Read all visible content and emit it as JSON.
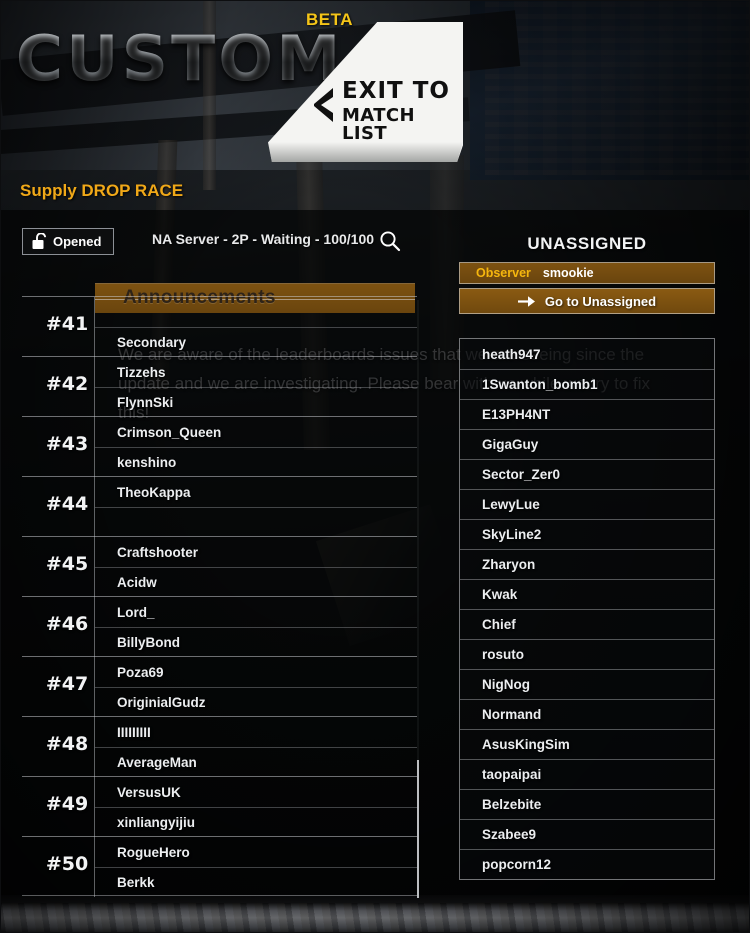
{
  "header": {
    "title": "CUSTOM",
    "beta_badge": "BETA",
    "exit_button": {
      "line1": "EXIT TO",
      "line2": "MATCH LIST",
      "icon": "chevron-left-icon"
    },
    "mode_label": "Supply DROP RACE"
  },
  "statusbar": {
    "lock": {
      "label": "Opened",
      "icon": "unlocked-padlock-icon"
    },
    "server_info": "NA Server - 2P - Waiting - 100/100",
    "search_icon": "search-icon"
  },
  "announcements": {
    "title": "Announcements",
    "body": "We are aware of the leaderboards issues that we are seeing since the update and we are investigating. Please bear with us while we try to fix this!"
  },
  "teams": [
    {
      "number": "#41",
      "slots": [
        "",
        "Secondary"
      ]
    },
    {
      "number": "#42",
      "slots": [
        "Tizzehs",
        "FlynnSki"
      ]
    },
    {
      "number": "#43",
      "slots": [
        "Crimson_Queen",
        "kenshino"
      ]
    },
    {
      "number": "#44",
      "slots": [
        "TheoKappa",
        ""
      ]
    },
    {
      "number": "#45",
      "slots": [
        "Craftshooter",
        "Acidw"
      ]
    },
    {
      "number": "#46",
      "slots": [
        "Lord_",
        "BillyBond"
      ]
    },
    {
      "number": "#47",
      "slots": [
        "Poza69",
        "OriginialGudz"
      ]
    },
    {
      "number": "#48",
      "slots": [
        "IIIIIIIII",
        "AverageMan"
      ]
    },
    {
      "number": "#49",
      "slots": [
        "VersusUK",
        "xinliangyijiu"
      ]
    },
    {
      "number": "#50",
      "slots": [
        "RogueHero",
        "Berkk"
      ]
    }
  ],
  "unassigned": {
    "title": "UNASSIGNED",
    "observer": {
      "label": "Observer",
      "name": "smookie"
    },
    "goto_button": {
      "label": "Go to Unassigned",
      "icon": "arrow-right-icon"
    },
    "players": [
      "heath947",
      "1Swanton_bomb1",
      "E13PH4NT",
      "GigaGuy",
      "Sector_Zer0",
      "LewyLue",
      "SkyLine2",
      "Zharyon",
      "Kwak",
      "Chief",
      "rosuto",
      "NigNog",
      "Normand",
      "AsusKingSim",
      "taopaipai",
      "Belzebite",
      "Szabee9",
      "popcorn12"
    ]
  },
  "colors": {
    "accent_gold": "#f5c518",
    "mode_orange": "#f0a818",
    "panel_brown": "#7d5211",
    "observer_gold": "#f5b60e",
    "text_primary": "#eceef0",
    "background_dark": "#0a0b0d"
  }
}
